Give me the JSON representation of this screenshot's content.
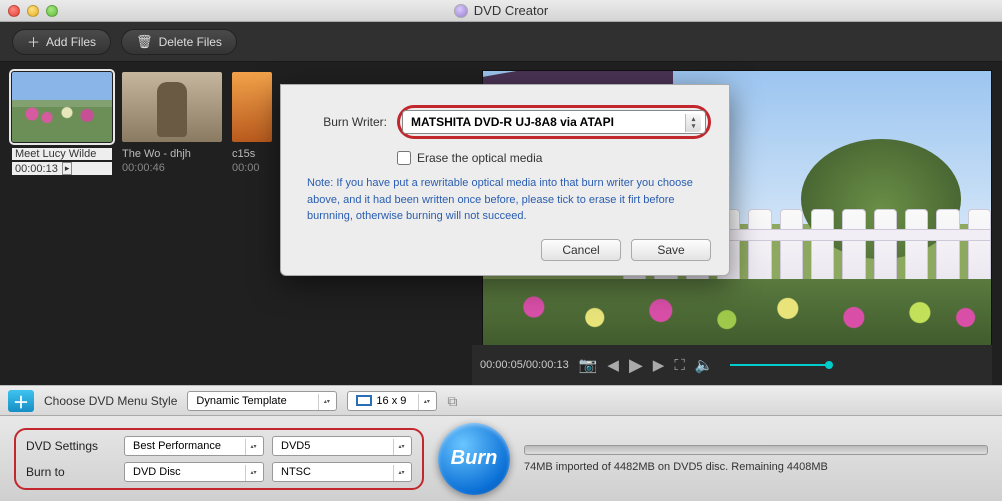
{
  "app": {
    "title": "DVD Creator"
  },
  "toolbar": {
    "add_files": "Add Files",
    "delete_files": "Delete Files"
  },
  "thumbs": [
    {
      "title": "Meet Lucy Wilde",
      "time": "00:00:13"
    },
    {
      "title": "The Wo - dhjh",
      "time": "00:00:46"
    },
    {
      "title": "c15s",
      "time": "00:00"
    }
  ],
  "player": {
    "time_current": "00:00:05",
    "time_total": "00:00:13"
  },
  "dialog": {
    "writer_label": "Burn Writer:",
    "writer_value": "MATSHITA DVD-R   UJ-8A8 via ATAPI",
    "erase_label": "Erase the optical media",
    "note": "Note: If you have put a rewritable optical media into that burn writer you choose above, and it had been written once before, please tick to erase it firt before burnning, otherwise burning will not succeed.",
    "cancel": "Cancel",
    "save": "Save"
  },
  "menu": {
    "choose_label": "Choose DVD Menu Style",
    "template": "Dynamic Template",
    "ratio": "16 x 9"
  },
  "bottom": {
    "settings_label": "DVD Settings",
    "burnto_label": "Burn to",
    "perf": "Best Performance",
    "disc_type": "DVD5",
    "target": "DVD Disc",
    "standard": "NTSC",
    "burn_btn": "Burn",
    "status": "74MB imported of 4482MB on DVD5 disc. Remaining 4408MB"
  }
}
